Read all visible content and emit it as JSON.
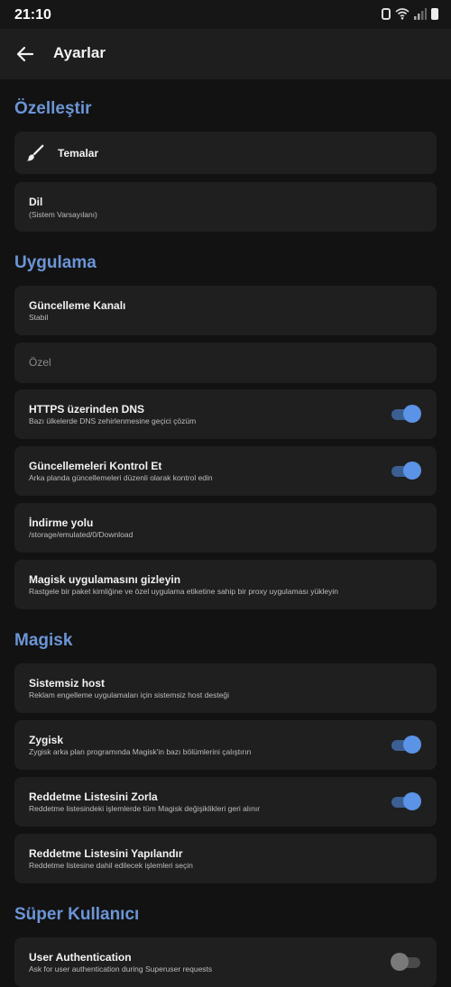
{
  "status_bar": {
    "time": "21:10"
  },
  "app_bar": {
    "title": "Ayarlar"
  },
  "sections": {
    "customize": "Özelleştir",
    "app": "Uygulama",
    "magisk": "Magisk",
    "superuser": "Süper Kullanıcı"
  },
  "items": {
    "themes": {
      "title": "Temalar"
    },
    "language": {
      "title": "Dil",
      "sub": "(Sistem Varsayılanı)"
    },
    "update_channel": {
      "title": "Güncelleme Kanalı",
      "sub": "Stabil"
    },
    "custom": {
      "title": "Özel"
    },
    "doh": {
      "title": "HTTPS üzerinden DNS",
      "sub": "Bazı ülkelerde DNS zehirlenmesine geçici çözüm",
      "on": true
    },
    "check_updates": {
      "title": "Güncellemeleri Kontrol Et",
      "sub": "Arka planda güncellemeleri düzenli olarak kontrol edin",
      "on": true
    },
    "download_path": {
      "title": "İndirme yolu",
      "sub": "/storage/emulated/0/Download"
    },
    "hide_app": {
      "title": "Magisk uygulamasını gizleyin",
      "sub": "Rastgele bir paket kimliğine ve özel uygulama etiketine sahip bir proxy uygulaması yükleyin"
    },
    "systemless_host": {
      "title": "Sistemsiz host",
      "sub": "Reklam engelleme uygulamaları için sistemsiz host desteği"
    },
    "zygisk": {
      "title": "Zygisk",
      "sub": "Zygisk arka plan programında Magisk'in bazı bölümlerini çalıştırın",
      "on": true
    },
    "enforce_denylist": {
      "title": "Reddetme Listesini Zorla",
      "sub": "Reddetme listesindeki işlemlerde tüm Magisk değişiklikleri geri alınır",
      "on": true
    },
    "configure_denylist": {
      "title": "Reddetme Listesini Yapılandır",
      "sub": "Reddetme listesine dahil edilecek işlemleri seçin"
    },
    "user_auth": {
      "title": "User Authentication",
      "sub": "Ask for user authentication during Superuser requests",
      "on": false
    }
  }
}
